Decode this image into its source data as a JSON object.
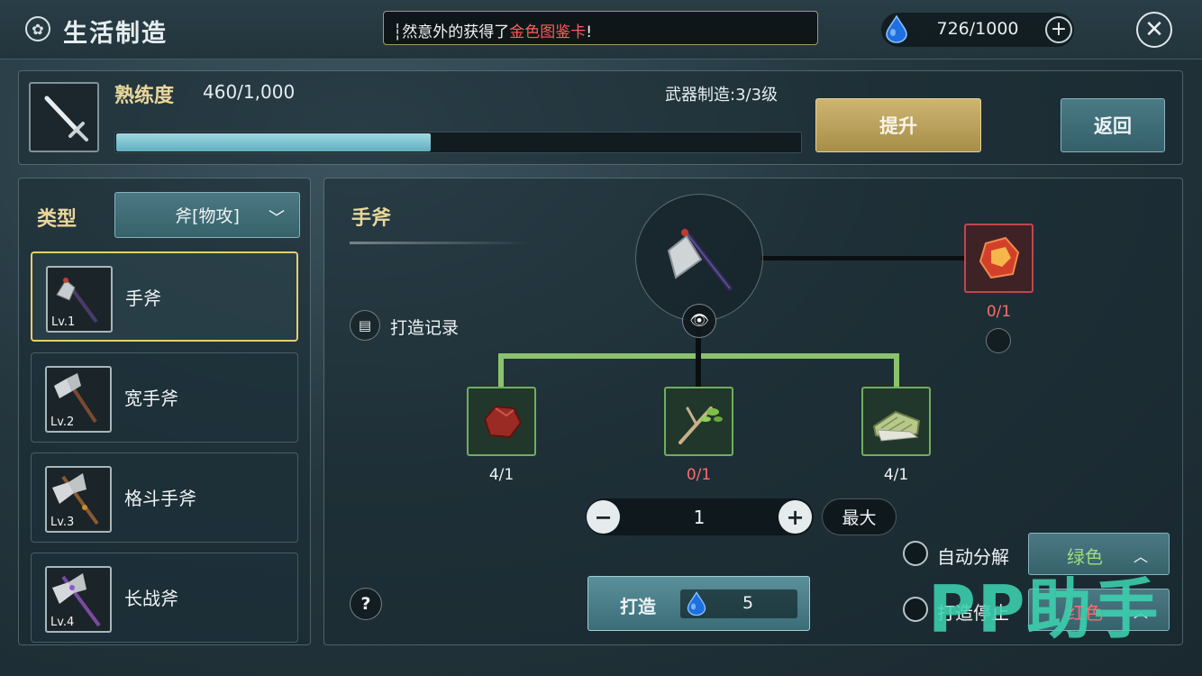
{
  "header": {
    "title": "生活制造",
    "notice_prefix": "┆然意外的获得了",
    "notice_highlight": "金色图鉴卡",
    "notice_suffix": "!",
    "energy": "726/1000",
    "energy_icon": "water-drop-icon",
    "close_icon": "close-icon"
  },
  "proficiency": {
    "label": "熟练度",
    "value": "460/1,000",
    "progress_fraction": 0.46,
    "weapon_level": "武器制造:3/3级",
    "upgrade_label": "提升",
    "back_label": "返回"
  },
  "sidebar": {
    "type_label": "类型",
    "type_value": "斧[物攻]",
    "items": [
      {
        "name": "手斧",
        "level": "Lv.1"
      },
      {
        "name": "宽手斧",
        "level": "Lv.2"
      },
      {
        "name": "格斗手斧",
        "level": "Lv.3"
      },
      {
        "name": "长战斧",
        "level": "Lv.4"
      }
    ]
  },
  "recipe": {
    "title": "手斧",
    "record_label": "打造记录",
    "extra_material_qty": "0/1",
    "materials": [
      {
        "icon": "ore-icon",
        "qty": "4/1"
      },
      {
        "icon": "branch-icon",
        "qty": "0/1"
      },
      {
        "icon": "cloth-icon",
        "qty": "4/1"
      }
    ],
    "quantity": "1",
    "max_label": "最大",
    "craft_label": "打造",
    "craft_cost": "5",
    "help_label": "?",
    "auto_dismantle_label": "自动分解",
    "auto_dismantle_grade": "绿色",
    "stop_craft_label": "打造停止",
    "stop_craft_grade": "红色"
  },
  "colors": {
    "gold_title": "#e9d79a",
    "warning_red": "#ff6b6b",
    "green_grade": "#9fdc7a",
    "red_grade": "#ff6b6b",
    "accent_teal": "#5fb0c0"
  },
  "watermark": "PP助手"
}
